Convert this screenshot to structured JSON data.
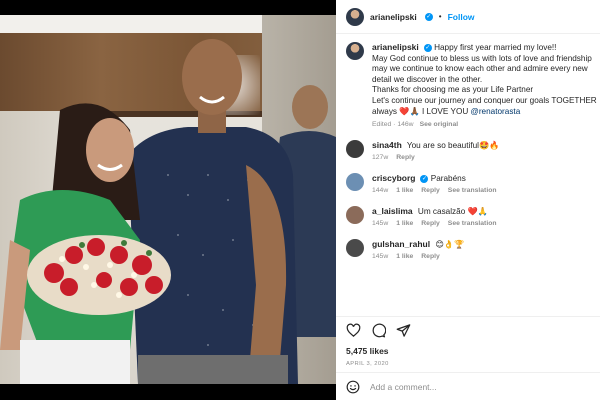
{
  "post": {
    "username": "arianelipski",
    "follow_label": "Follow",
    "separator": "•",
    "caption": {
      "line1": "Happy first year married my love!!",
      "line2": "May God continue to bless us with lots of love and friendship",
      "line3": "may we continue to know each other and admire every new",
      "line4": "detail we discover in the other.",
      "line5": "Thanks for choosing me as your Life Partner",
      "line6": "Let's continue our journey and conquer our goals TOGETHER",
      "line7_text": "always ❤️🙏🏾 I LOVE YOU",
      "line7_mention": "@renatorasta"
    },
    "caption_meta": {
      "edited": "Edited",
      "age": "146w",
      "see_original": "See original"
    },
    "comments": [
      {
        "username": "sina4th",
        "text": "You are so beautiful🤩🔥",
        "age": "127w",
        "likes": "",
        "reply": "Reply",
        "translate": "",
        "verified": false,
        "avatar_color": "#3b3b3b"
      },
      {
        "username": "criscyborg",
        "text": "Parabéns",
        "age": "144w",
        "likes": "1 like",
        "reply": "Reply",
        "translate": "See translation",
        "verified": true,
        "avatar_color": "#6c8fb3"
      },
      {
        "username": "a_laislima",
        "text": "Um casalzão ❤️🙏",
        "age": "145w",
        "likes": "1 like",
        "reply": "Reply",
        "translate": "See translation",
        "verified": false,
        "avatar_color": "#8b6b5a"
      },
      {
        "username": "gulshan_rahul",
        "text": "😊👌🏆",
        "age": "145w",
        "likes": "1 like",
        "reply": "Reply",
        "translate": "",
        "verified": false,
        "avatar_color": "#4a4a4a"
      }
    ],
    "likes": "5,475 likes",
    "date": "APRIL 3, 2020",
    "add_comment_placeholder": "Add a comment...",
    "icons": {
      "like": "heart-icon",
      "comment": "comment-icon",
      "share": "share-icon",
      "emoji": "emoji-icon",
      "verified": "verified-badge-icon"
    },
    "colors": {
      "link_blue": "#0095f6",
      "mention": "#00376b",
      "muted": "#8e8e8e",
      "text": "#262626"
    }
  }
}
